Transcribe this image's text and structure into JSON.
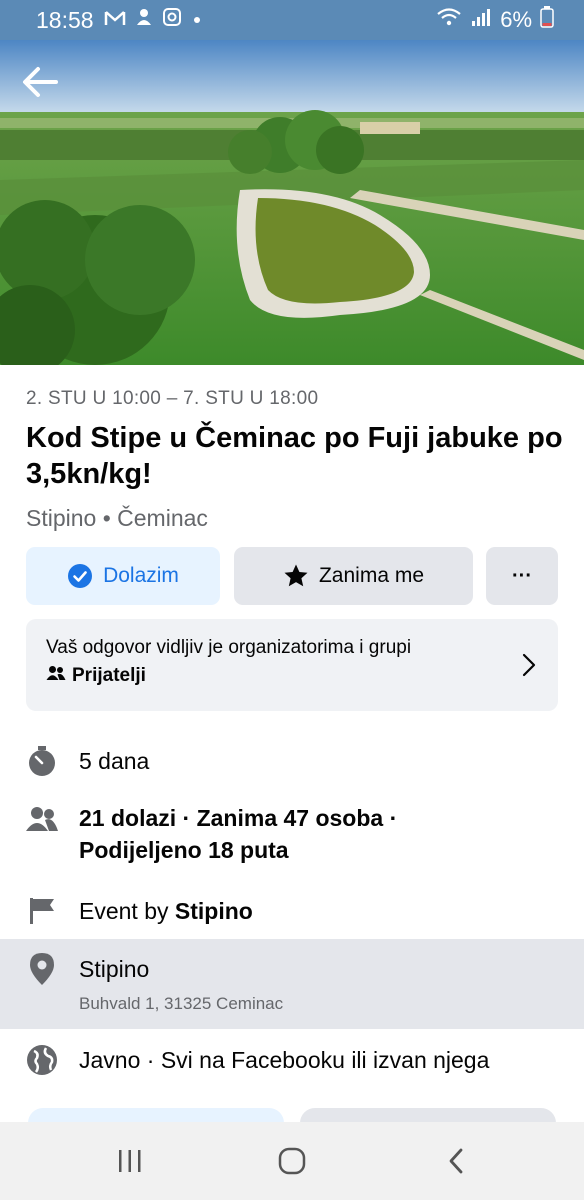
{
  "status_bar": {
    "time": "18:58",
    "battery": "6%",
    "icons": [
      "gmail-icon",
      "ghost-icon",
      "instagram-icon",
      "dot-icon",
      "wifi-icon",
      "signal-icon",
      "battery-icon"
    ]
  },
  "event": {
    "date_range": "2. STU U 10:00 – 7. STU U 18:00",
    "title": "Kod Stipe u Čeminac po Fuji jabuke po 3,5kn/kg!",
    "host_location": "Stipino • Čeminac"
  },
  "actions": {
    "going_label": "Dolazim",
    "interested_label": "Zanima me",
    "more_label": "···"
  },
  "visibility": {
    "text": "Vaš odgovor vidljiv je organizatorima i grupi",
    "audience": "Prijatelji"
  },
  "details": {
    "duration": "5 dana",
    "attendance_line1": "21 dolazi · Zanima 47 osoba ·",
    "attendance_line2": "Podijeljeno 18 puta",
    "event_by_prefix": "Event by ",
    "event_by_name": "Stipino",
    "place_name": "Stipino",
    "place_address": "Buhvald 1, 31325 Ceminac",
    "privacy": "Javno · Svi na Facebooku ili izvan njega"
  },
  "colors": {
    "accent": "#1b74e4",
    "status_bar": "#5b8ab6",
    "secondary_text": "#65676b",
    "button_gray": "#e4e6eb"
  }
}
